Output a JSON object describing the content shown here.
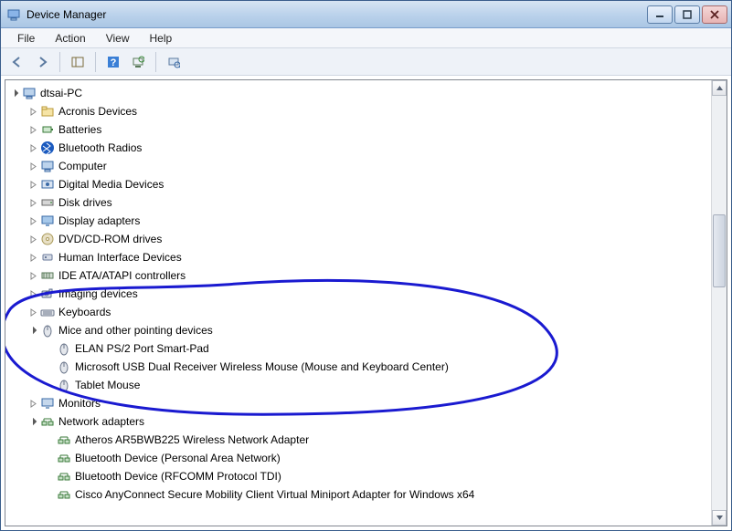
{
  "window": {
    "title": "Device Manager"
  },
  "menu": {
    "file": "File",
    "action": "Action",
    "view": "View",
    "help": "Help"
  },
  "tree": {
    "root": "dtsai-PC",
    "categories": [
      {
        "label": "Acronis Devices",
        "expanded": false
      },
      {
        "label": "Batteries",
        "expanded": false
      },
      {
        "label": "Bluetooth Radios",
        "expanded": false
      },
      {
        "label": "Computer",
        "expanded": false
      },
      {
        "label": "Digital Media Devices",
        "expanded": false
      },
      {
        "label": "Disk drives",
        "expanded": false
      },
      {
        "label": "Display adapters",
        "expanded": false
      },
      {
        "label": "DVD/CD-ROM drives",
        "expanded": false
      },
      {
        "label": "Human Interface Devices",
        "expanded": false
      },
      {
        "label": "IDE ATA/ATAPI controllers",
        "expanded": false
      },
      {
        "label": "Imaging devices",
        "expanded": false
      },
      {
        "label": "Keyboards",
        "expanded": false
      },
      {
        "label": "Mice and other pointing devices",
        "expanded": true,
        "children": [
          {
            "label": "ELAN PS/2 Port Smart-Pad"
          },
          {
            "label": "Microsoft USB Dual Receiver Wireless Mouse (Mouse and Keyboard Center)"
          },
          {
            "label": "Tablet Mouse"
          }
        ]
      },
      {
        "label": "Monitors",
        "expanded": false
      },
      {
        "label": "Network adapters",
        "expanded": true,
        "children": [
          {
            "label": "Atheros AR5BWB225 Wireless Network Adapter"
          },
          {
            "label": "Bluetooth Device (Personal Area Network)"
          },
          {
            "label": "Bluetooth Device (RFCOMM Protocol TDI)"
          },
          {
            "label": "Cisco AnyConnect Secure Mobility Client Virtual Miniport Adapter for Windows x64"
          }
        ]
      }
    ]
  },
  "icons": {
    "root": "computer",
    "categories": [
      "folder",
      "battery",
      "bluetooth",
      "computer",
      "media",
      "disk",
      "display",
      "dvd",
      "hid",
      "ide",
      "camera",
      "keyboard",
      "mouse",
      "monitor",
      "network"
    ]
  }
}
